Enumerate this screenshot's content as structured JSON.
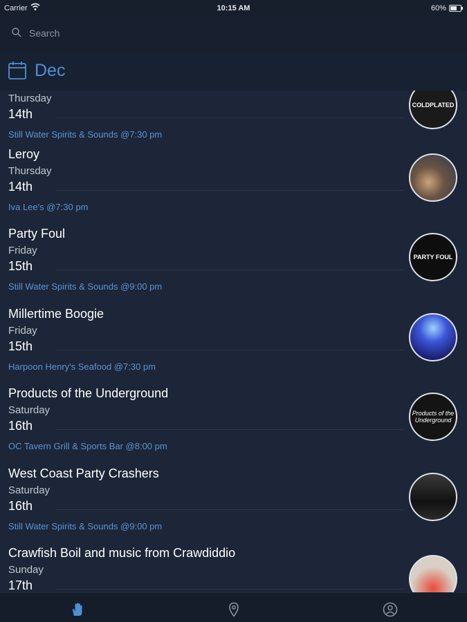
{
  "status_bar": {
    "carrier": "Carrier",
    "time": "10:15 AM",
    "battery": "60%"
  },
  "search": {
    "placeholder": "Search"
  },
  "header": {
    "month": "Dec",
    "accent_color": "#4e8fd6"
  },
  "events": [
    {
      "title": "",
      "weekday": "Thursday",
      "day": "14th",
      "venue": "Still Water Spirits & Sounds @7:30 pm",
      "thumb_text": "COLDPLATED",
      "thumb_color": "#1a1a1a"
    },
    {
      "title": "Leroy",
      "weekday": "Thursday",
      "day": "14th",
      "venue": "Iva Lee's @7:30 pm",
      "thumb_text": "",
      "thumb_color": "#5b4a3c"
    },
    {
      "title": "Party Foul",
      "weekday": "Friday",
      "day": "15th",
      "venue": "Still Water Spirits & Sounds @9:00 pm",
      "thumb_text": "PARTY FOUL",
      "thumb_color": "#0e0e0e"
    },
    {
      "title": "Millertime Boogie",
      "weekday": "Friday",
      "day": "15th",
      "venue": "Harpoon Henry's Seafood @7:30 pm",
      "thumb_text": "",
      "thumb_color": "#2b3fb8"
    },
    {
      "title": "Products of the Underground",
      "weekday": "Saturday",
      "day": "16th",
      "venue": "OC Tavern Grill & Sports Bar @8:00 pm",
      "thumb_text": "Products of the Underground",
      "thumb_color": "#141414"
    },
    {
      "title": "West Coast Party Crashers",
      "weekday": "Saturday",
      "day": "16th",
      "venue": "Still Water Spirits & Sounds @9:00 pm",
      "thumb_text": "",
      "thumb_color": "#2a2a2a"
    },
    {
      "title": "Crawfish Boil and music from Crawdiddio",
      "weekday": "Sunday",
      "day": "17th",
      "venue": "",
      "thumb_text": "",
      "thumb_color": "#d8d0c4"
    }
  ],
  "tab_bar": {
    "tabs": [
      {
        "icon": "hand-icon",
        "active": true
      },
      {
        "icon": "location-pin-icon",
        "active": false
      },
      {
        "icon": "profile-icon",
        "active": false
      }
    ],
    "active_color": "#4e8fd6",
    "inactive_color": "#8a93a3"
  }
}
